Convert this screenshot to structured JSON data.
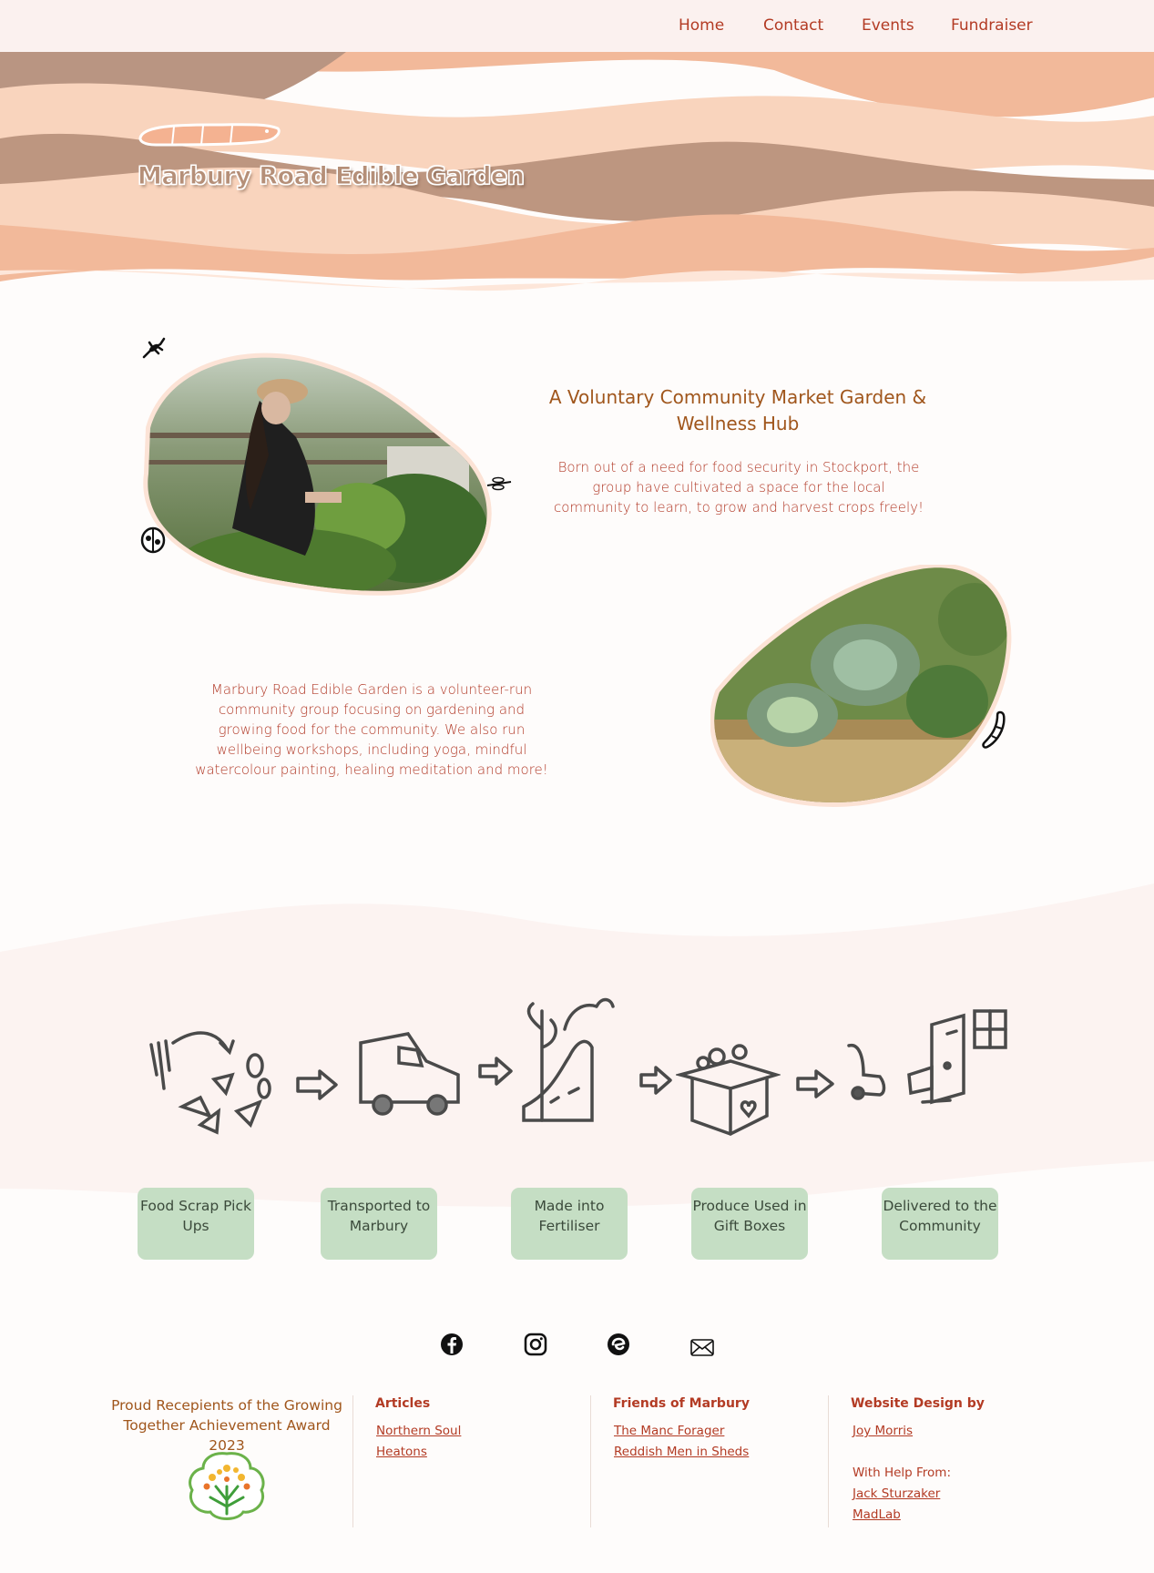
{
  "nav": {
    "items": [
      "Home",
      "Contact",
      "Events",
      "Fundraiser"
    ]
  },
  "hero": {
    "title": "Marbury Road Edible Garden"
  },
  "intro": {
    "heading": "A Voluntary Community Market Garden & Wellness Hub",
    "paragraph": "Born out of a need for food security in Stockport, the group have cultivated a space for the local community to learn, to grow and harvest crops freely!"
  },
  "about": {
    "paragraph": "Marbury Road Edible Garden is a volunteer-run community group focusing on gardening and growing food for the community. We also run wellbeing workshops, including yoga, mindful watercolour painting, healing meditation and more!"
  },
  "process": {
    "steps": [
      {
        "label": "Food Scrap Pick Ups",
        "icon": "food-scraps-icon"
      },
      {
        "label": "Transported to Marbury",
        "icon": "van-icon"
      },
      {
        "label": "Made into Fertiliser",
        "icon": "compost-icon"
      },
      {
        "label": "Produce Used in Gift Boxes",
        "icon": "gift-box-icon"
      },
      {
        "label": "Delivered to the Community",
        "icon": "delivery-icon"
      }
    ]
  },
  "social": [
    "facebook-icon",
    "instagram-icon",
    "eventbrite-icon",
    "email-icon"
  ],
  "footer": {
    "award_text": "Proud Recepients of the Growing Together Achievement Award 2023",
    "articles": {
      "heading": "Articles",
      "links": [
        "Northern Soul",
        "Heatons"
      ]
    },
    "friends": {
      "heading": "Friends of Marbury",
      "links": [
        "The Manc Forager",
        "Reddish Men in Sheds"
      ]
    },
    "design": {
      "heading": "Website Design by",
      "designer": "Joy Morris",
      "help_label": "With Help From:",
      "helpers": [
        "Jack Sturzaker",
        "MadLab"
      ]
    }
  },
  "colors": {
    "accent": "#b33b24",
    "heading": "#a0561c",
    "step_box": "#c5dec4",
    "nav_bg": "#fbf1ef"
  }
}
